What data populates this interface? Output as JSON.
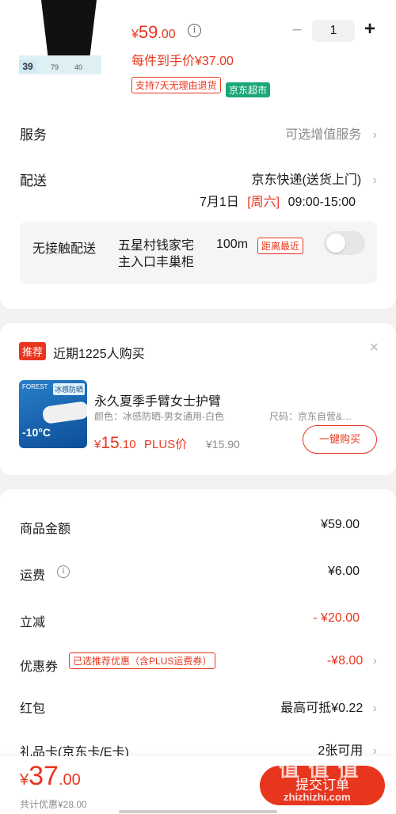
{
  "product": {
    "thumb_badge_left": "39",
    "thumb_stats": [
      "79",
      "40"
    ],
    "price_symbol": "¥",
    "price_int": "59",
    "price_dec": ".00",
    "info_icon": "info-icon",
    "per_item_label": "每件到手价¥37.00",
    "quantity": "1",
    "minus": "−",
    "plus": "+",
    "return_tag": "支持7天无理由退货",
    "supermarket_tag": "京东超市"
  },
  "service": {
    "label": "服务",
    "value": "可选增值服务"
  },
  "delivery": {
    "label": "配送",
    "method": "京东快递(送货上门)",
    "date": "7月1日",
    "weekday": "[周六]",
    "time": "09:00-15:00"
  },
  "contactless": {
    "label": "无接触配送",
    "location": "五星村钱家宅 主入口丰巢柜",
    "distance": "100m",
    "nearest_tag": "距离最近",
    "toggle_on": false
  },
  "recommend": {
    "badge": "推荐",
    "title": "近期1225人购买",
    "thumb_tag": "冰感防晒",
    "thumb_brand": "FOREST",
    "thumb_temp": "-10°C",
    "product_name": "永久夏季手臂女士护臂",
    "spec_color": "颜色：冰感防晒-男女通用-白色",
    "spec_size": "尺码：京东自营&…",
    "price_symbol": "¥",
    "price_int": "15",
    "price_dec": ".10",
    "plus_label": "PLUS价",
    "orig_price": "¥15.90",
    "buy_button": "一键购买"
  },
  "summary": {
    "items": [
      {
        "label": "商品金额",
        "value": "¥59.00"
      },
      {
        "label": "运费",
        "value": "¥6.00"
      },
      {
        "label": "立减",
        "value": "- ¥20.00"
      },
      {
        "label": "优惠券",
        "value": "-¥8.00",
        "tag": "已选推荐优惠（含PLUS运费券）"
      },
      {
        "label": "红包",
        "value": "最高可抵¥0.22"
      },
      {
        "label": "礼品卡(京东卡/E卡)",
        "value": "2张可用"
      }
    ]
  },
  "footer": {
    "total_symbol": "¥",
    "total_int": "37",
    "total_dec": ".00",
    "saved": "共计优惠¥28.00",
    "submit": "提交订单",
    "watermark": "值 值 值",
    "watermark_site": "zhizhizhi.com"
  },
  "colors": {
    "accent": "#e8361e",
    "supermarket": "#1aa77a"
  }
}
